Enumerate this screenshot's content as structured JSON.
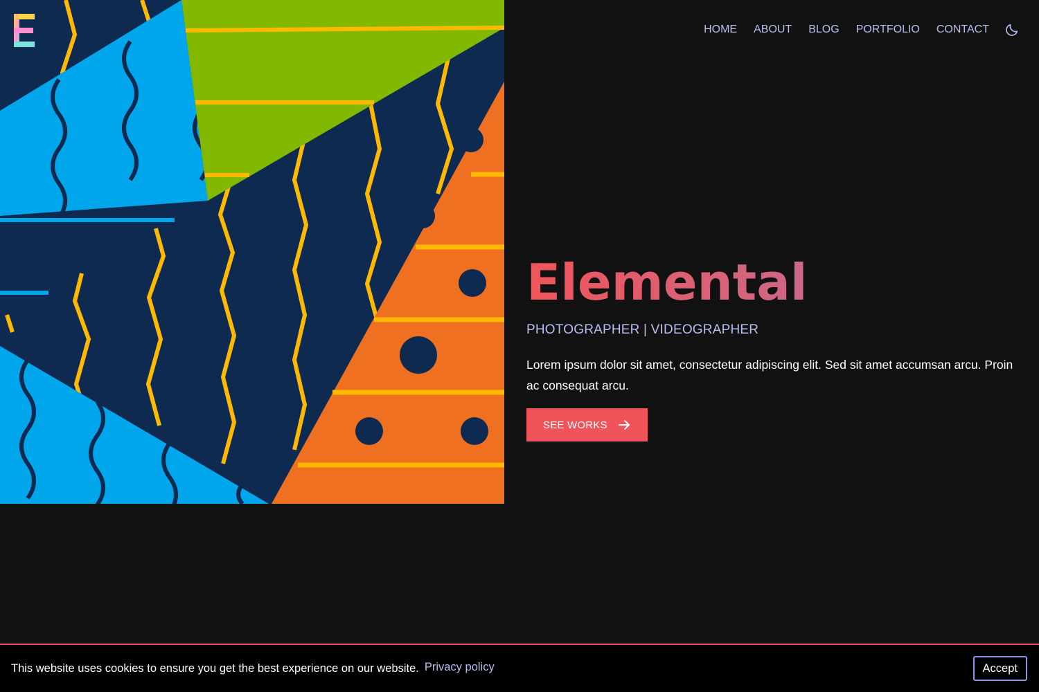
{
  "brand": {
    "logo_letter": "E",
    "logo_icon": "elemental-logo-icon"
  },
  "nav": {
    "items": [
      {
        "label": "HOME",
        "active": true
      },
      {
        "label": "ABOUT",
        "active": false
      },
      {
        "label": "BLOG",
        "active": false
      },
      {
        "label": "PORTFOLIO",
        "active": false
      },
      {
        "label": "CONTACT",
        "active": false
      }
    ],
    "theme_toggle_icon": "moon-icon"
  },
  "hero": {
    "title": "Elemental",
    "subtitle": "PHOTOGRAPHER | VIDEOGRAPHER",
    "description": "Lorem ipsum dolor sit amet, consectetur adipiscing elit. Sed sit amet accumsan arcu. Proin ac consequat arcu.",
    "cta_label": "SEE WORKS",
    "cta_icon": "arrow-right-icon"
  },
  "cookie": {
    "message": "This website uses cookies to ensure you get the best experience on our website.",
    "link_label": "Privacy policy",
    "accept_label": "Accept"
  },
  "colors": {
    "background": "#111111",
    "accent": "#f0545a",
    "nav_text": "#b9bff0",
    "art_navy": "#0e2a50",
    "art_blue": "#00a6ec",
    "art_green": "#82b900",
    "art_orange": "#f07022",
    "art_yellow": "#ffb900"
  }
}
